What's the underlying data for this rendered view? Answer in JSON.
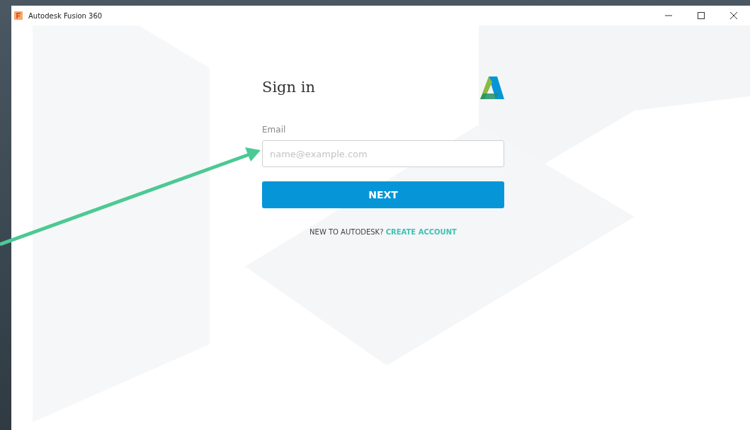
{
  "window": {
    "title": "Autodesk Fusion 360"
  },
  "sign_in": {
    "heading": "Sign in",
    "email_label": "Email",
    "email": {
      "placeholder": "name@example.com"
    },
    "next_button": "NEXT",
    "signup_prompt": "NEW TO AUTODESK?",
    "signup_link": "CREATE ACCOUNT"
  }
}
